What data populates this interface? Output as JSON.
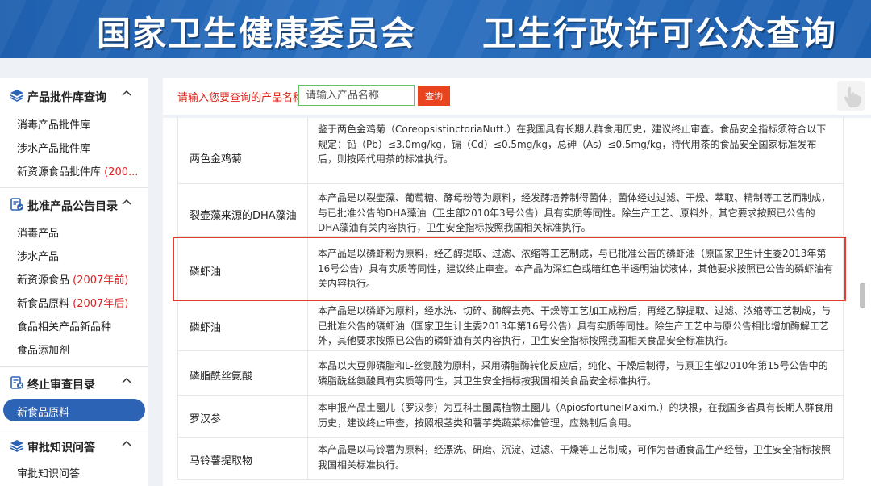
{
  "banner": {
    "left_title": "国家卫生健康委员会",
    "right_title": "卫生行政许可公众查询"
  },
  "sidebar": {
    "sections": [
      {
        "title": "产品批件库查询",
        "icon": "stack-layers-icon",
        "items": [
          {
            "label": "消毒产品批件库",
            "note": ""
          },
          {
            "label": "涉水产品批件库",
            "note": ""
          },
          {
            "label": "新资源食品批件库",
            "note": "(200..."
          }
        ]
      },
      {
        "title": "批准产品公告目录",
        "icon": "document-check-icon",
        "items": [
          {
            "label": "消毒产品",
            "note": ""
          },
          {
            "label": "涉水产品",
            "note": ""
          },
          {
            "label": "新资源食品",
            "note": "(2007年前)"
          },
          {
            "label": "新食品原料",
            "note": "(2007年后)"
          },
          {
            "label": "食品相关产品新品种",
            "note": ""
          },
          {
            "label": "食品添加剂",
            "note": ""
          }
        ]
      },
      {
        "title": "终止审查目录",
        "icon": "document-stop-icon",
        "items": [
          {
            "label": "新食品原料",
            "note": "",
            "active": true
          }
        ]
      },
      {
        "title": "审批知识问答",
        "icon": "stack-layers-icon",
        "items": [
          {
            "label": "审批知识问答",
            "note": ""
          }
        ]
      }
    ]
  },
  "search": {
    "label": "请输入您要查询的产品名称",
    "placeholder": "请输入产品名称",
    "value": "",
    "button_label": "查询"
  },
  "table": {
    "rows": [
      {
        "name": "两色金鸡菊",
        "desc": "鉴于两色金鸡菊（CoreopsistinctoriaNutt.）在我国具有长期人群食用历史，建议终止审查。食品安全指标须符合以下规定：铅（Pb）≤3.0mg/kg，镉（Cd）≤0.5mg/kg，总砷（As）≤0.5mg/kg，待代用茶的食品安全国家标准发布后，则按照代用茶的标准执行。"
      },
      {
        "name": "裂壶藻来源的DHA藻油",
        "desc": "本产品是以裂壶藻、葡萄糖、酵母粉等为原料，经发酵培养制得菌体，菌体经过过滤、干燥、萃取、精制等工艺而制成，与已批准公告的DHA藻油（卫生部2010年3号公告）具有实质等同性。除生产工艺、原料外，其它要求按照已公告的DHA藻油有关内容执行，卫生安全指标按照我国相关标准执行。"
      },
      {
        "name": "磷虾油",
        "desc": "本产品是以磷虾粉为原料，经乙醇提取、过滤、浓缩等工艺制成，与已批准公告的磷虾油（原国家卫生计生委2013年第16号公告）具有实质等同性，建议终止审查。本产品为深红色或暗红色半透明油状液体，其他要求按照已公告的磷虾油有关内容执行。",
        "highlighted": true
      },
      {
        "name": "磷虾油",
        "desc": "本产品是以磷虾为原料，经水洗、切碎、酶解去壳、干燥等工艺加工成粉后，再经乙醇提取、过滤、浓缩等工艺制成，与已批准公告的磷虾油（国家卫生计生委2013年第16号公告）具有实质等同性。除生产工艺中与原公告相比增加酶解工艺外，其他要求按照已公告的磷虾油有关内容执行，卫生安全指标按照我国相关食品安全标准执行。"
      },
      {
        "name": "磷脂酰丝氨酸",
        "desc": "本品以大豆卵磷脂和L-丝氨酸为原料，采用磷脂酶转化反应后，纯化、干燥后制得，与原卫生部2010年第15号公告中的磷脂酰丝氨酸具有实质等同性，其卫生安全指标按我国相关食品安全标准执行。"
      },
      {
        "name": "罗汉参",
        "desc": "本申报产品土圞儿（罗汉参）为豆科土圞属植物土圞儿（ApiosfortuneiMaxim.）的块根，在我国多省具有长期人群食用历史，建议终止审查，按照根茎类和薯芋类蔬菜标准管理，应熟制后食用。"
      },
      {
        "name": "马铃薯提取物",
        "desc": "本产品是以马铃薯为原料，经漂洗、研磨、沉淀、过滤、干燥等工艺制成，可作为普通食品生产经营，卫生安全指标按照我国相关标准执行。"
      }
    ]
  },
  "colors": {
    "banner": "#2a6fbf",
    "sidebar_active": "#2d63b4",
    "search_button": "#e8451e",
    "note_red": "#e02020",
    "highlight_border": "#e33b30"
  }
}
